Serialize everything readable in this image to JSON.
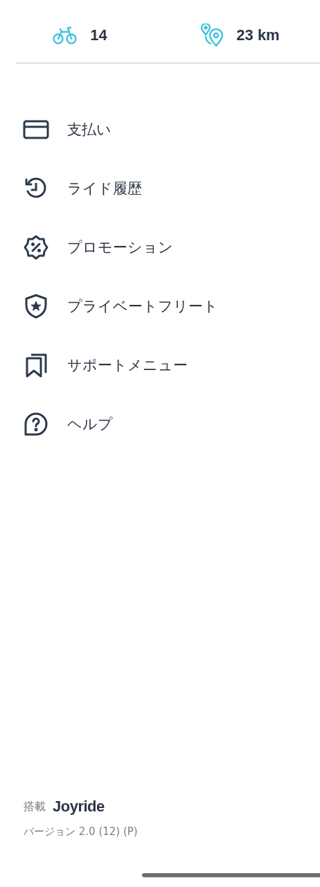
{
  "stats": [
    {
      "kind": "bike",
      "value": "14"
    },
    {
      "kind": "route",
      "value": "23 km"
    }
  ],
  "menu": [
    {
      "kind": "card",
      "label": "支払い"
    },
    {
      "kind": "history",
      "label": "ライド履歴"
    },
    {
      "kind": "promo",
      "label": "プロモーション"
    },
    {
      "kind": "shield",
      "label": "プライベートフリート"
    },
    {
      "kind": "bookmarks",
      "label": "サポートメニュー"
    },
    {
      "kind": "help",
      "label": "ヘルプ"
    }
  ],
  "footer": {
    "powered_by": "搭載",
    "brand": "Joyride",
    "version": "バージョン 2.0 (12) (P)"
  }
}
